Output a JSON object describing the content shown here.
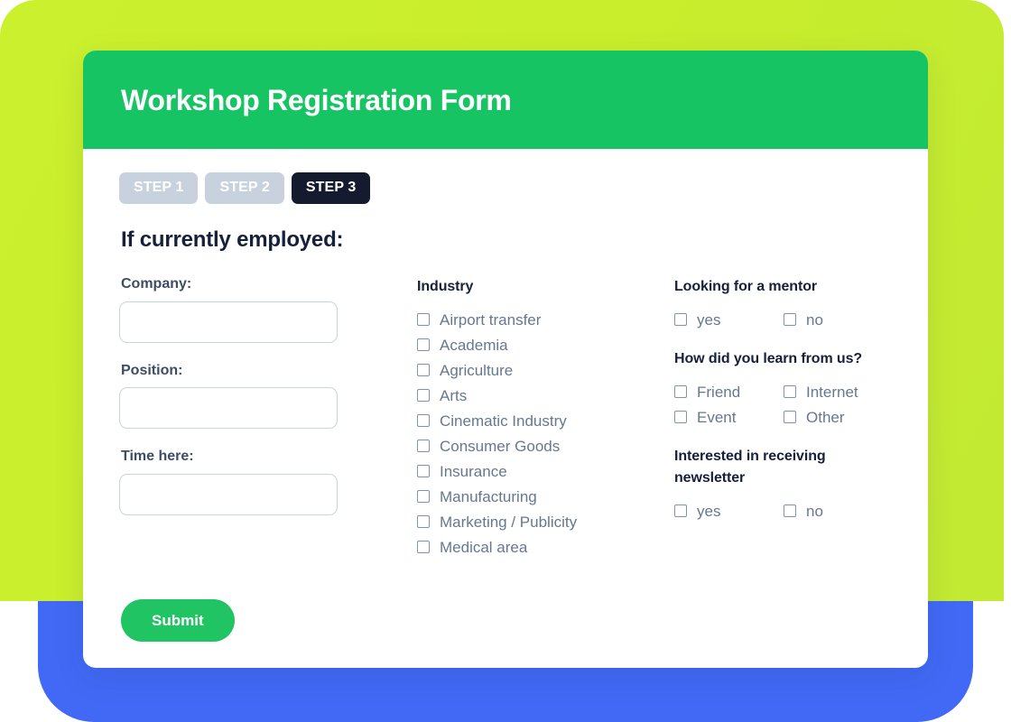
{
  "background": {
    "lime_color": "#C9EE2B",
    "blue_color": "#4169F5"
  },
  "header": {
    "title": "Workshop Registration Form",
    "background_color": "#16C464"
  },
  "steps": [
    {
      "label": "STEP 1",
      "state": "inactive"
    },
    {
      "label": "STEP 2",
      "state": "inactive"
    },
    {
      "label": "STEP 3",
      "state": "active"
    }
  ],
  "section": {
    "title": "If currently employed:"
  },
  "employment_fields": [
    {
      "label": "Company:",
      "value": "",
      "placeholder": ""
    },
    {
      "label": "Position:",
      "value": "",
      "placeholder": ""
    },
    {
      "label": "Time here:",
      "value": "",
      "placeholder": ""
    }
  ],
  "industry": {
    "heading": "Industry",
    "options": [
      {
        "label": "Airport transfer",
        "checked": false
      },
      {
        "label": "Academia",
        "checked": false
      },
      {
        "label": "Agriculture",
        "checked": false
      },
      {
        "label": "Arts",
        "checked": false
      },
      {
        "label": "Cinematic Industry",
        "checked": false
      },
      {
        "label": "Consumer Goods",
        "checked": false
      },
      {
        "label": "Insurance",
        "checked": false
      },
      {
        "label": "Manufacturing",
        "checked": false
      },
      {
        "label": "Marketing / Publicity",
        "checked": false
      },
      {
        "label": "Medical area",
        "checked": false
      }
    ]
  },
  "mentor": {
    "heading": "Looking for a mentor",
    "options": [
      {
        "label": "yes",
        "checked": false
      },
      {
        "label": "no",
        "checked": false
      }
    ]
  },
  "referral": {
    "heading": "How did you learn from us?",
    "options": [
      {
        "label": "Friend",
        "checked": false
      },
      {
        "label": "Internet",
        "checked": false
      },
      {
        "label": "Event",
        "checked": false
      },
      {
        "label": "Other",
        "checked": false
      }
    ]
  },
  "newsletter": {
    "heading": "Interested in receiving newsletter",
    "options": [
      {
        "label": "yes",
        "checked": false
      },
      {
        "label": "no",
        "checked": false
      }
    ]
  },
  "submit": {
    "label": "Submit",
    "color": "#20C463"
  }
}
